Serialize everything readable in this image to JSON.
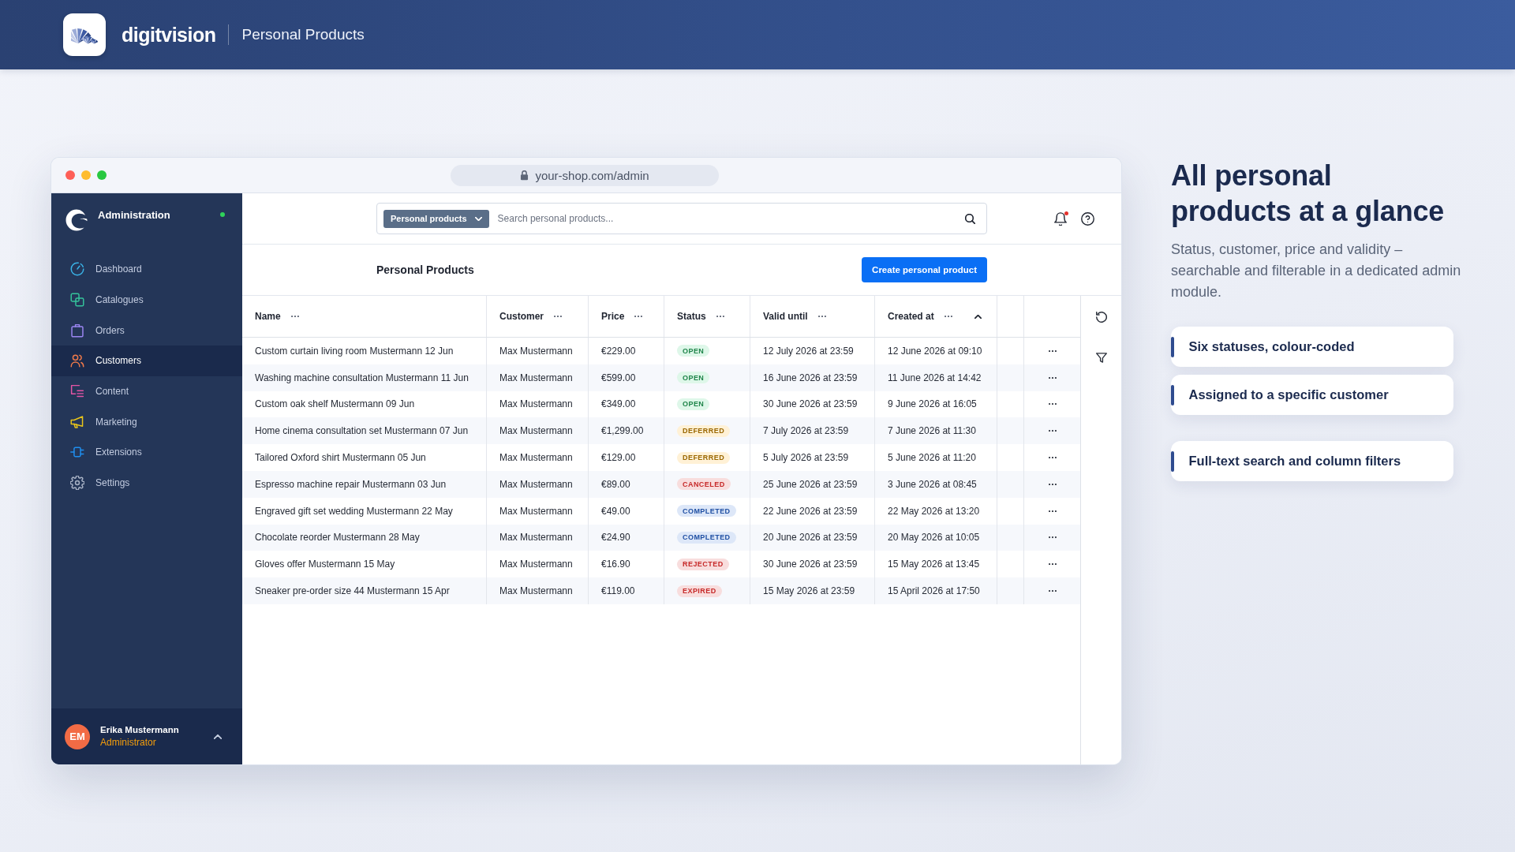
{
  "header": {
    "brand": "digitvision",
    "title": "Personal Products"
  },
  "browser": {
    "url": "your-shop.com/admin"
  },
  "sidebar": {
    "title": "Administration",
    "online": true,
    "items": [
      {
        "label": "Dashboard",
        "color": "#3ab4e8",
        "selected": false
      },
      {
        "label": "Catalogues",
        "color": "#35c49b",
        "selected": false
      },
      {
        "label": "Orders",
        "color": "#9b86f2",
        "selected": false
      },
      {
        "label": "Customers",
        "color": "#f07a4a",
        "selected": true
      },
      {
        "label": "Content",
        "color": "#e455a6",
        "selected": false
      },
      {
        "label": "Marketing",
        "color": "#e9c51a",
        "selected": false
      },
      {
        "label": "Extensions",
        "color": "#1f8ff0",
        "selected": false
      },
      {
        "label": "Settings",
        "color": "#a9b3c6",
        "selected": false
      }
    ],
    "user": {
      "initials": "EM",
      "name": "Erika Mustermann",
      "role": "Administrator"
    }
  },
  "topbar": {
    "search_scope": "Personal products",
    "search": {
      "placeholder": "Search personal products..."
    },
    "notifications_unread": true
  },
  "page": {
    "title": "Personal Products",
    "create_button": "Create personal product"
  },
  "table": {
    "columns": [
      {
        "label": "Name",
        "sorted": false
      },
      {
        "label": "Customer",
        "sorted": false
      },
      {
        "label": "Price",
        "sorted": false
      },
      {
        "label": "Status",
        "sorted": false
      },
      {
        "label": "Valid until",
        "sorted": false
      },
      {
        "label": "Created at",
        "sorted": true
      }
    ],
    "rows": [
      {
        "name": "Custom curtain living room Mustermann 12 Jun",
        "customer": "Max Mustermann",
        "price": "€229.00",
        "status": {
          "label": "OPEN",
          "color": "#1e8449"
        },
        "valid_until": "12 July 2026 at 23:59",
        "created_at": "12 June 2026 at 09:10"
      },
      {
        "name": "Washing machine consultation Mustermann 11 Jun",
        "customer": "Max Mustermann",
        "price": "€599.00",
        "status": {
          "label": "OPEN",
          "color": "#1e8449"
        },
        "valid_until": "16 June 2026 at 23:59",
        "created_at": "11 June 2026 at 14:42"
      },
      {
        "name": "Custom oak shelf Mustermann 09 Jun",
        "customer": "Max Mustermann",
        "price": "€349.00",
        "status": {
          "label": "OPEN",
          "color": "#1e8449"
        },
        "valid_until": "30 June 2026 at 23:59",
        "created_at": "9 June 2026 at 16:05"
      },
      {
        "name": "Home cinema consultation set Mustermann 07 Jun",
        "customer": "Max Mustermann",
        "price": "€1,299.00",
        "status": {
          "label": "DEFERRED",
          "color": "#9a6700"
        },
        "valid_until": "7 July 2026 at 23:59",
        "created_at": "7 June 2026 at 11:30"
      },
      {
        "name": "Tailored Oxford shirt Mustermann 05 Jun",
        "customer": "Max Mustermann",
        "price": "€129.00",
        "status": {
          "label": "DEFERRED",
          "color": "#9a6700"
        },
        "valid_until": "5 July 2026 at 23:59",
        "created_at": "5 June 2026 at 11:20"
      },
      {
        "name": "Espresso machine repair Mustermann 03 Jun",
        "customer": "Max Mustermann",
        "price": "€89.00",
        "status": {
          "label": "CANCELED",
          "color": "#c62828"
        },
        "valid_until": "25 June 2026 at 23:59",
        "created_at": "3 June 2026 at 08:45"
      },
      {
        "name": "Engraved gift set wedding Mustermann 22 May",
        "customer": "Max Mustermann",
        "price": "€49.00",
        "status": {
          "label": "COMPLETED",
          "color": "#1f4fa3"
        },
        "valid_until": "22 June 2026 at 23:59",
        "created_at": "22 May 2026 at 13:20"
      },
      {
        "name": "Chocolate reorder Mustermann 28 May",
        "customer": "Max Mustermann",
        "price": "€24.90",
        "status": {
          "label": "COMPLETED",
          "color": "#1f4fa3"
        },
        "valid_until": "20 June 2026 at 23:59",
        "created_at": "20 May 2026 at 10:05"
      },
      {
        "name": "Gloves offer Mustermann 15 May",
        "customer": "Max Mustermann",
        "price": "€16.90",
        "status": {
          "label": "REJECTED",
          "color": "#c62828"
        },
        "valid_until": "30 June 2026 at 23:59",
        "created_at": "15 May 2026 at 13:45"
      },
      {
        "name": "Sneaker pre-order size 44 Mustermann 15 Apr",
        "customer": "Max Mustermann",
        "price": "€119.00",
        "status": {
          "label": "EXPIRED",
          "color": "#c62828"
        },
        "valid_until": "15 May 2026 at 23:59",
        "created_at": "15 April 2026 at 17:50"
      }
    ]
  },
  "feature_panel": {
    "title": "All personal products at a glance",
    "description": "Status, customer, price and validity – searchable and filterable in a dedicated admin module.",
    "features": [
      "Six statuses, colour-coded",
      "Assigned to a specific customer",
      "Full-text search and column filters"
    ]
  }
}
